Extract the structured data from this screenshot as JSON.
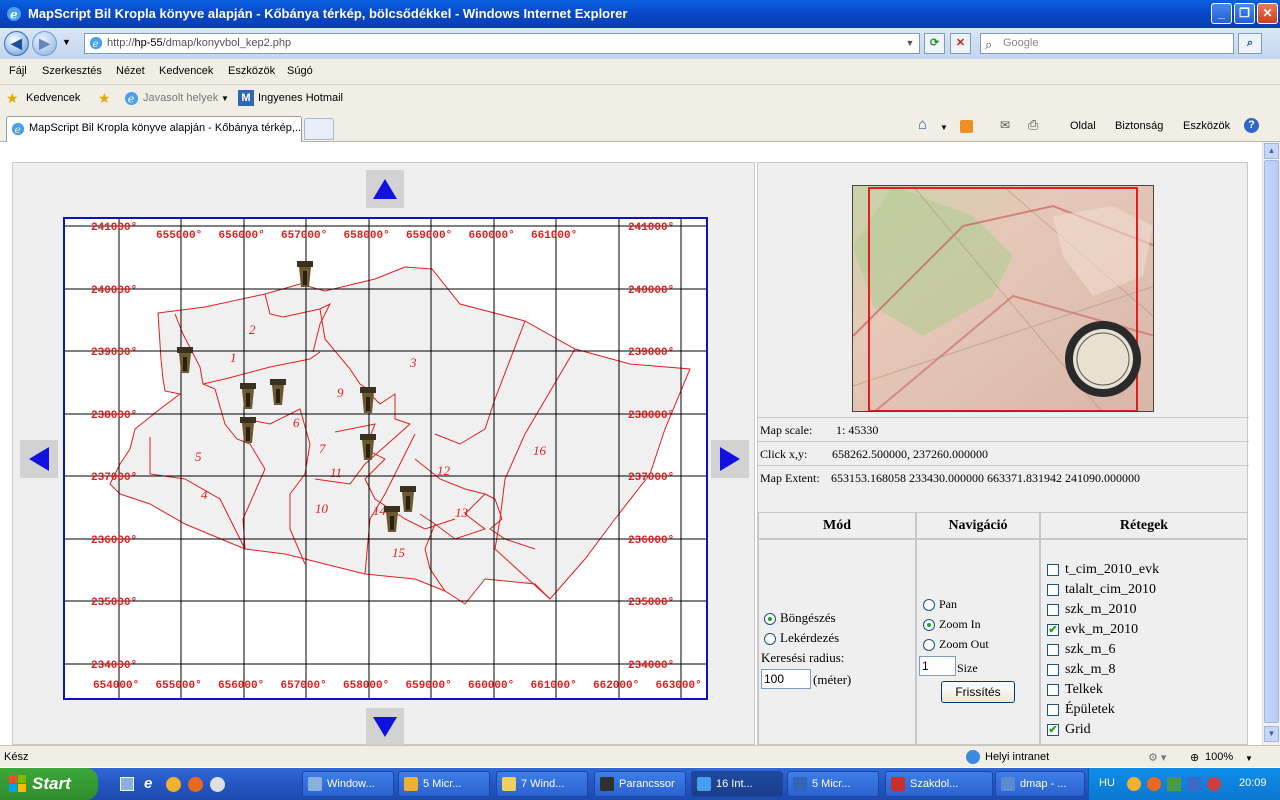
{
  "window": {
    "title": "MapScript Bil Kropla könyve alapján - Kőbánya térkép, bölcsődékkel - Windows Internet Explorer",
    "buttons": {
      "minimize": "_",
      "maximize": "❐",
      "close": "✕"
    }
  },
  "navbar": {
    "address_prefix": "http://",
    "address_host": "hp-55",
    "address_path": "/dmap/konyvbol_kep2.php",
    "search_placeholder": "Google"
  },
  "menu": [
    "Fájl",
    "Szerkesztés",
    "Nézet",
    "Kedvencek",
    "Eszközök",
    "Súgó"
  ],
  "favorites": {
    "label": "Kedvencek",
    "items": [
      "Javasolt helyek",
      "Ingyenes Hotmail"
    ]
  },
  "tabs": [
    {
      "label": "MapScript Bil Kropla könyve alapján - Kőbánya térkép,..."
    }
  ],
  "commandbar": [
    "Oldal",
    "Biztonság",
    "Eszközök"
  ],
  "map": {
    "x_labels_top": [
      "655000°",
      "656000°",
      "657000°",
      "658000°",
      "659000°",
      "660000°",
      "661000°"
    ],
    "x_labels_bottom": [
      "654000°",
      "655000°",
      "656000°",
      "657000°",
      "658000°",
      "659000°",
      "660000°",
      "661000°",
      "662000°",
      "663000°"
    ],
    "y_labels": [
      "241000°",
      "240000°",
      "239000°",
      "238000°",
      "237000°",
      "236000°",
      "235000°",
      "234000°"
    ],
    "district_numbers": [
      "1",
      "2",
      "3",
      "4",
      "5",
      "6",
      "7",
      "9",
      "10",
      "11",
      "12",
      "13",
      "14",
      "15",
      "16"
    ],
    "marker_color": "#6b5a30",
    "boundary_color": "#e02020",
    "grid_color": "#000000",
    "frame_color": "#1010c0"
  },
  "info": {
    "scale_label": "Map scale:",
    "scale_value": "1: 45330",
    "click_label": "Click x,y:",
    "click_value": "658262.500000, 237260.000000",
    "extent_label": "Map Extent:",
    "extent_value": "653153.168058 233430.000000 663371.831942 241090.000000"
  },
  "panels": {
    "mode": {
      "header": "Mód",
      "options": [
        "Böngészés",
        "Lekérdezés"
      ],
      "selected": "Böngészés",
      "radius_label": "Keresési radius:",
      "radius_value": "100",
      "radius_unit": "(méter)"
    },
    "navigation": {
      "header": "Navigáció",
      "options": [
        "Pan",
        "Zoom In",
        "Zoom Out"
      ],
      "selected": "Zoom In",
      "size_value": "1",
      "size_label": "Size",
      "refresh_label": "Frissítés"
    },
    "layers": {
      "header": "Rétegek",
      "items": [
        {
          "label": "t_cim_2010_evk",
          "checked": false
        },
        {
          "label": "talalt_cim_2010",
          "checked": false
        },
        {
          "label": "szk_m_2010",
          "checked": false
        },
        {
          "label": "evk_m_2010",
          "checked": true
        },
        {
          "label": "szk_m_6",
          "checked": false
        },
        {
          "label": "szk_m_8",
          "checked": false
        },
        {
          "label": "Telkek",
          "checked": false
        },
        {
          "label": "Épületek",
          "checked": false
        },
        {
          "label": "Grid",
          "checked": true
        }
      ]
    }
  },
  "status": {
    "text": "Kész",
    "zone": "Helyi intranet",
    "zoom": "100%"
  },
  "taskbar": {
    "start": "Start",
    "buttons": [
      "Window...",
      "5 Micr...",
      "7 Wind...",
      "Parancssor",
      "16 Int...",
      "5 Micr...",
      "Szakdol...",
      "dmap - ..."
    ],
    "language": "HU",
    "time": "20:09"
  }
}
